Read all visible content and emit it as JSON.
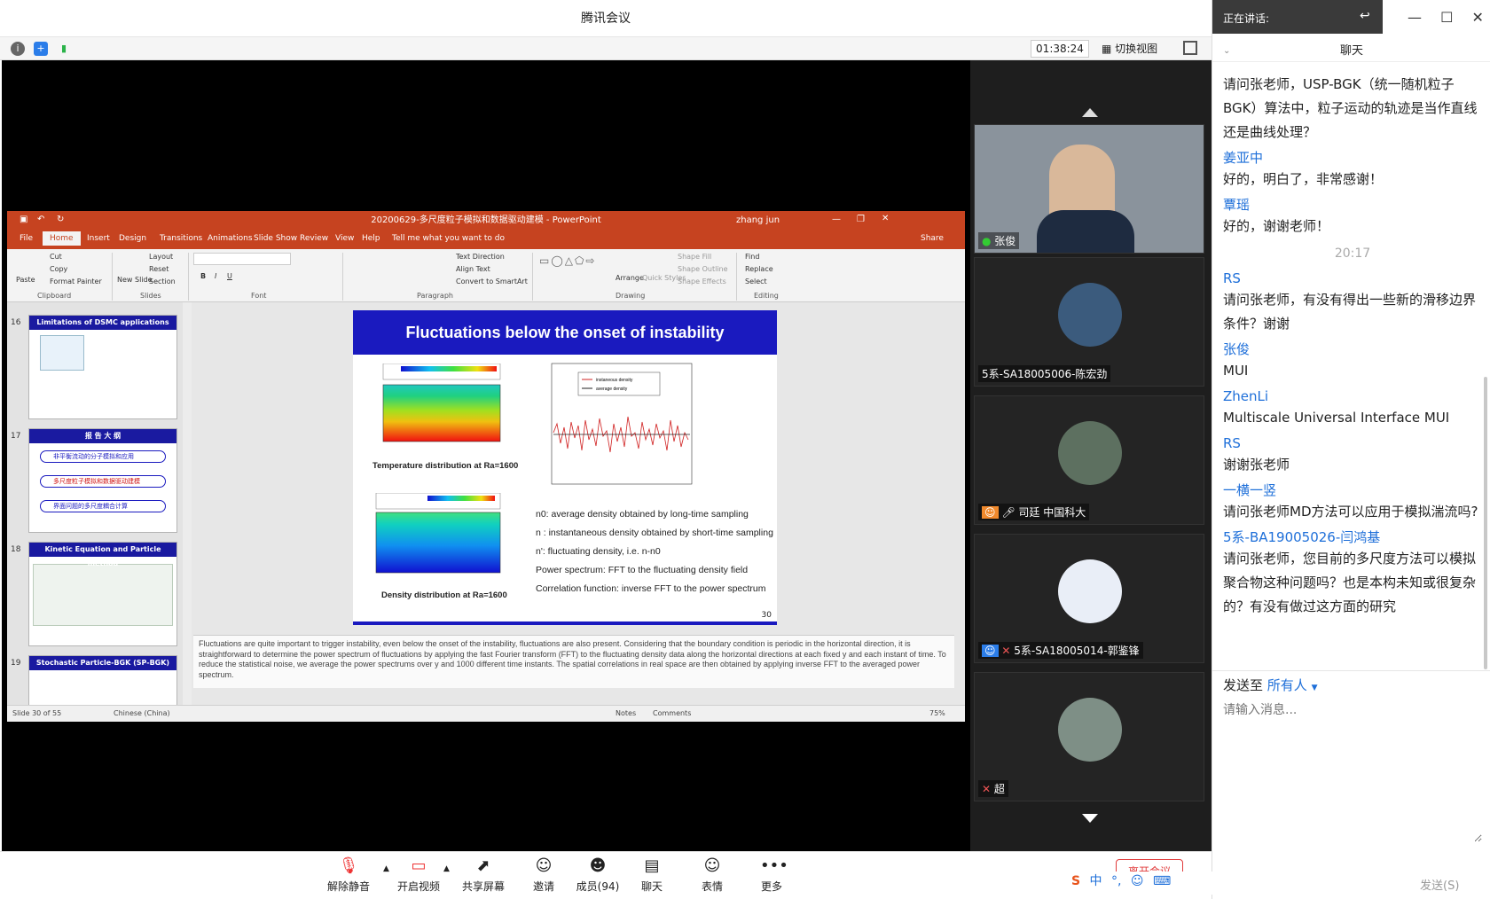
{
  "window": {
    "title": "腾讯会议"
  },
  "status_bar": {
    "timer": "01:38:24",
    "switch_view": "切换视图"
  },
  "speaking": {
    "label": "正在讲话:"
  },
  "ppt": {
    "title": "20200629-多尺度粒子模拟和数据驱动建模 - PowerPoint",
    "user": "zhang jun",
    "share": "Share",
    "tell_me": "Tell me what you want to do",
    "menu": [
      "File",
      "Home",
      "Insert",
      "Design",
      "Transitions",
      "Animations",
      "Slide Show",
      "Review",
      "View",
      "Help"
    ],
    "ribbon": {
      "paste": "Paste",
      "cut": "Cut",
      "copy": "Copy",
      "format_painter": "Format Painter",
      "new_slide": "New Slide",
      "layout": "Layout",
      "reset": "Reset",
      "section": "Section",
      "text_direction": "Text Direction",
      "align_text": "Align Text",
      "convert_smartart": "Convert to SmartArt",
      "arrange": "Arrange",
      "quick_styles": "Quick Styles",
      "shape_fill": "Shape Fill",
      "shape_outline": "Shape Outline",
      "shape_effects": "Shape Effects",
      "find": "Find",
      "replace": "Replace",
      "select": "Select",
      "groups": [
        "Clipboard",
        "Slides",
        "Font",
        "Paragraph",
        "Drawing",
        "Editing"
      ]
    },
    "thumbnails": [
      {
        "num": "16",
        "title": "Limitations of DSMC applications"
      },
      {
        "num": "17",
        "title": "报 告 大 纲",
        "items": [
          "非平衡流动的分子模拟和应用",
          "多尺度粒子模拟和数据驱动建模",
          "界面问题的多尺度耦合计算"
        ]
      },
      {
        "num": "18",
        "title": "Kinetic Equation and Particle method"
      },
      {
        "num": "19",
        "title": "Stochastic Particle-BGK (SP-BGK) method"
      }
    ],
    "slide": {
      "title": "Fluctuations below the onset of instability",
      "caption_temp": "Temperature distribution at Ra=1600",
      "caption_density": "Density distribution at Ra=1600",
      "bullets": [
        "n0: average density obtained by long-time sampling",
        "n : instantaneous density obtained by short-time sampling",
        "n': fluctuating density, i.e. n-n0",
        "Power spectrum: FFT to the fluctuating density field",
        "Correlation function: inverse FFT to the power spectrum"
      ],
      "legend": [
        "instaneous density",
        "average density"
      ],
      "page_number": "30"
    },
    "notes": "Fluctuations are quite important to trigger instability, even below the onset of the instability, fluctuations are also present. Considering that the boundary condition is periodic in the horizontal direction, it is straightforward to determine the power spectrum of fluctuations by applying the fast Fourier transform (FFT) to the fluctuating density data along the horizontal directions at each fixed y and each instant of time. To reduce the statistical noise, we average the power spectrums over y and 1000 different time instants. The spatial correlations in real space are then obtained by applying inverse FFT to the averaged power spectrum.",
    "status": {
      "slide_info": "Slide 30 of 55",
      "language": "Chinese (China)",
      "notes": "Notes",
      "comments": "Comments",
      "zoom": "75%"
    }
  },
  "participants": [
    {
      "name": "张俊"
    },
    {
      "name": "5系-SA18005006-陈宏劲"
    },
    {
      "name": "司廷 中国科大"
    },
    {
      "name": "5系-SA18005014-郭鉴锋"
    },
    {
      "name": "超"
    }
  ],
  "toolbar": {
    "unmute": "解除静音",
    "start_video": "开启视频",
    "share_screen": "共享屏幕",
    "invite": "邀请",
    "members": "成员(94)",
    "chat": "聊天",
    "reactions": "表情",
    "more": "更多",
    "leave": "离开会议"
  },
  "chat": {
    "header": "聊天",
    "messages": [
      {
        "text": "请问张老师，USP-BGK（统一随机粒子BGK）算法中，粒子运动的轨迹是当作直线还是曲线处理？"
      },
      {
        "name": "姜亚中",
        "text": "好的，明白了，非常感谢！"
      },
      {
        "name": "覃瑶",
        "text": "好的，谢谢老师！"
      },
      {
        "time": "20:17"
      },
      {
        "name": "RS",
        "text": "请问张老师，有没有得出一些新的滑移边界条件？谢谢"
      },
      {
        "name": "张俊",
        "text": "MUI"
      },
      {
        "name": "ZhenLi",
        "text": "Multiscale Universal Interface MUI"
      },
      {
        "name": "RS",
        "text": "谢谢张老师"
      },
      {
        "name": "一横一竖",
        "text": "请问张老师MD方法可以应用于模拟湍流吗?"
      },
      {
        "name": "5系-BA19005026-闫鸿基",
        "text": "请问张老师，您目前的多尺度方法可以模拟聚合物这种问题吗？也是本构未知或很复杂的？有没有做过这方面的研究"
      }
    ],
    "send_to_label": "发送至",
    "send_to_target": "所有人",
    "input_placeholder": "请输入消息...",
    "send_button": "发送(S)"
  },
  "colors": {
    "ppt_accent": "#c64320",
    "slide_blue": "#1a1abf",
    "chat_name": "#1e6fd9",
    "leave_red": "#e03a3a"
  }
}
